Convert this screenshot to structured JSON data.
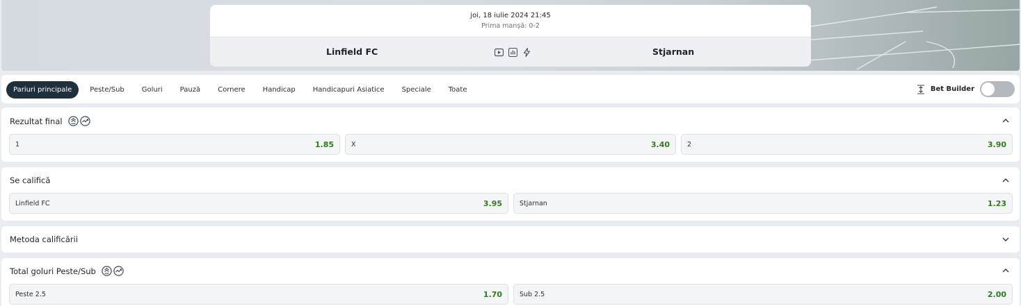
{
  "match": {
    "datetime": "joi, 18 iulie 2024 21:45",
    "first_leg": "Prima manșă: 0-2",
    "home_team": "Linfield FC",
    "away_team": "Stjarnan",
    "icons": [
      "play-video-icon",
      "stats-icon",
      "lightning-icon"
    ]
  },
  "tabs": [
    {
      "label": "Pariuri principale",
      "active": true
    },
    {
      "label": "Peste/Sub"
    },
    {
      "label": "Goluri"
    },
    {
      "label": "Pauză"
    },
    {
      "label": "Cornere"
    },
    {
      "label": "Handicap"
    },
    {
      "label": "Handicapuri Asiatice"
    },
    {
      "label": "Speciale"
    },
    {
      "label": "Toate"
    }
  ],
  "bet_builder": {
    "label": "Bet Builder",
    "enabled": false
  },
  "markets": {
    "final_result": {
      "title": "Rezultat final",
      "expanded": true,
      "badges": [
        "builder-badge-icon",
        "cashout-badge-icon"
      ],
      "odds": [
        {
          "label": "1",
          "value": "1.85"
        },
        {
          "label": "X",
          "value": "3.40"
        },
        {
          "label": "2",
          "value": "3.90"
        }
      ]
    },
    "qualify": {
      "title": "Se califică",
      "expanded": true,
      "odds": [
        {
          "label": "Linfield FC",
          "value": "3.95"
        },
        {
          "label": "Stjarnan",
          "value": "1.23"
        }
      ]
    },
    "qualify_method": {
      "title": "Metoda calificării",
      "expanded": false
    },
    "total_goals": {
      "title": "Total goluri Peste/Sub",
      "expanded": true,
      "badges": [
        "builder-badge-icon",
        "cashout-badge-icon"
      ],
      "odds": [
        {
          "label": "Peste 2.5",
          "value": "1.70"
        },
        {
          "label": "Sub 2.5",
          "value": "2.00"
        }
      ]
    }
  },
  "colors": {
    "odds_value": "#2f7d1f",
    "active_tab_bg": "#1f2f3d",
    "page_bg": "#e9ecf0"
  }
}
